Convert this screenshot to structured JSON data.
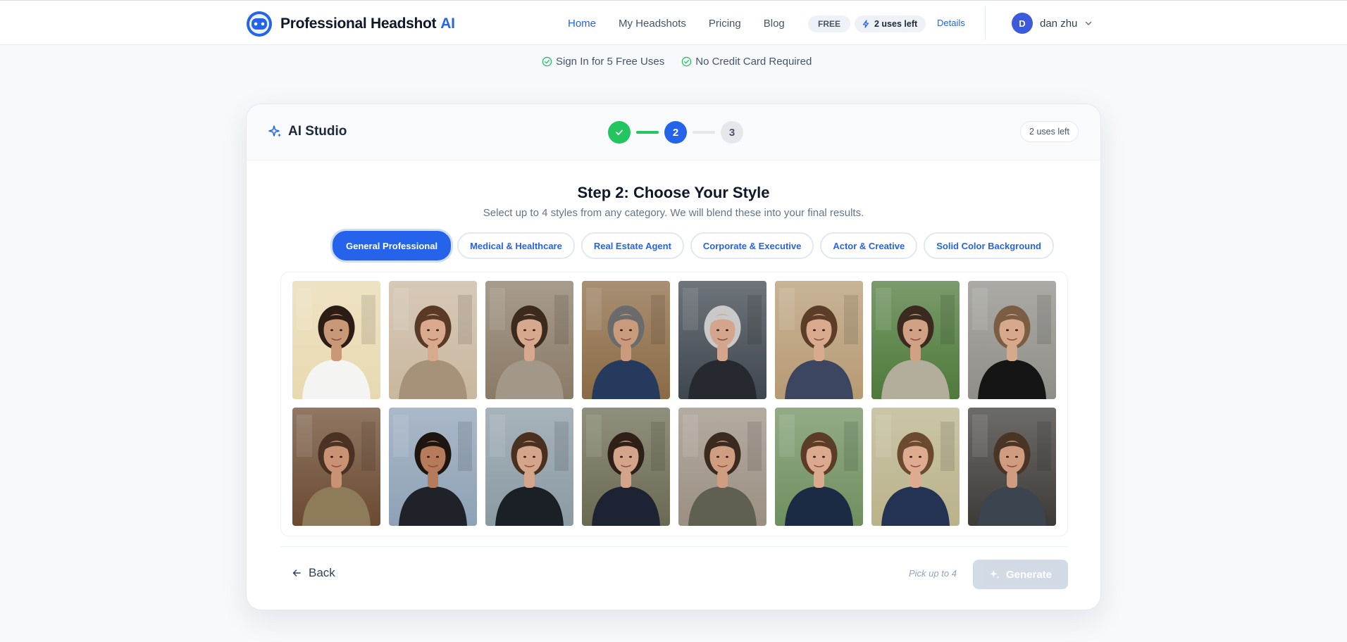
{
  "header": {
    "brand_name": "Professional Headshot",
    "brand_ai": "AI",
    "nav": [
      "Home",
      "My Headshots",
      "Pricing",
      "Blog"
    ],
    "plan_badge": "FREE",
    "uses_left": "2 uses left",
    "details_link": "Details",
    "user_initial": "D",
    "user_name": "dan zhu"
  },
  "benefits": [
    "Sign In for 5 Free Uses",
    "No Credit Card Required"
  ],
  "studio": {
    "title": "AI Studio",
    "uses_badge": "2 uses left",
    "steps": {
      "active": "2",
      "next": "3"
    },
    "step_title": "Step 2: Choose Your Style",
    "step_subtitle": "Select up to 4 styles from any category. We will blend these into your final results.",
    "tabs": [
      "General Professional",
      "Medical & Healthcare",
      "Real Estate Agent",
      "Corporate & Executive",
      "Actor & Creative",
      "Solid Color Background"
    ],
    "active_tab": "General Professional",
    "back_label": "Back",
    "pick_hint": "Pick up to 4",
    "generate_label": "Generate"
  },
  "styles": [
    {
      "icon": "portrait-woman-white-coat",
      "bg": "#e8d9b0",
      "coat": "#f4f4f2",
      "skin": "#c99876",
      "hair": "#2b1d16"
    },
    {
      "icon": "portrait-woman-cardigan",
      "bg": "#c9b79f",
      "coat": "#a69179",
      "skin": "#d8a98c",
      "hair": "#5a3a27"
    },
    {
      "icon": "portrait-woman-sweater",
      "bg": "#8a7a66",
      "coat": "#a3978a",
      "skin": "#d6a98e",
      "hair": "#3d2a1e"
    },
    {
      "icon": "portrait-man-library",
      "bg": "#8b6a45",
      "coat": "#263a5e",
      "skin": "#c99a7b",
      "hair": "#6b6b6b"
    },
    {
      "icon": "portrait-man-office-glass",
      "bg": "#3e464e",
      "coat": "#262a30",
      "skin": "#d2a58c",
      "hair": "#c9c9c9"
    },
    {
      "icon": "portrait-woman-blazer-arch",
      "bg": "#b69a74",
      "coat": "#3c4660",
      "skin": "#d9aa8e",
      "hair": "#5c3d28"
    },
    {
      "icon": "portrait-man-park",
      "bg": "#4e7a3a",
      "coat": "#b3ad9c",
      "skin": "#d0a185",
      "hair": "#3b2a20"
    },
    {
      "icon": "portrait-woman-black-top",
      "bg": "#8f8e88",
      "coat": "#151515",
      "skin": "#d6a88c",
      "hair": "#7a5d42"
    },
    {
      "icon": "portrait-man-cafe",
      "bg": "#6b4a30",
      "coat": "#8d7b5a",
      "skin": "#c99275",
      "hair": "#4a3325"
    },
    {
      "icon": "portrait-woman-sunset-city",
      "bg": "#8ea1b6",
      "coat": "#1f2329",
      "skin": "#b57b5a",
      "hair": "#1e1510"
    },
    {
      "icon": "portrait-woman-office-windows",
      "bg": "#8a9aa3",
      "coat": "#1b1f26",
      "skin": "#d4a58a",
      "hair": "#4a3020"
    },
    {
      "icon": "portrait-man-suit-campus",
      "bg": "#6a6a52",
      "coat": "#1d2333",
      "skin": "#d3a38a",
      "hair": "#2e2018"
    },
    {
      "icon": "portrait-man-open-office",
      "bg": "#9b8f82",
      "coat": "#5f5f52",
      "skin": "#cf9d80",
      "hair": "#3a2a20"
    },
    {
      "icon": "portrait-woman-greenhouse",
      "bg": "#6f8f5f",
      "coat": "#1d2a44",
      "skin": "#dba98e",
      "hair": "#5b3c26"
    },
    {
      "icon": "portrait-woman-park-path",
      "bg": "#b9b28a",
      "coat": "#243253",
      "skin": "#dcab90",
      "hair": "#6b4a30"
    },
    {
      "icon": "portrait-man-restaurant",
      "bg": "#3d3a37",
      "coat": "#3c4450",
      "skin": "#cf9c80",
      "hair": "#4a3426"
    }
  ],
  "colors": {
    "accent": "#2563eb",
    "success": "#22c55e",
    "disabled": "#cbd5e1"
  }
}
